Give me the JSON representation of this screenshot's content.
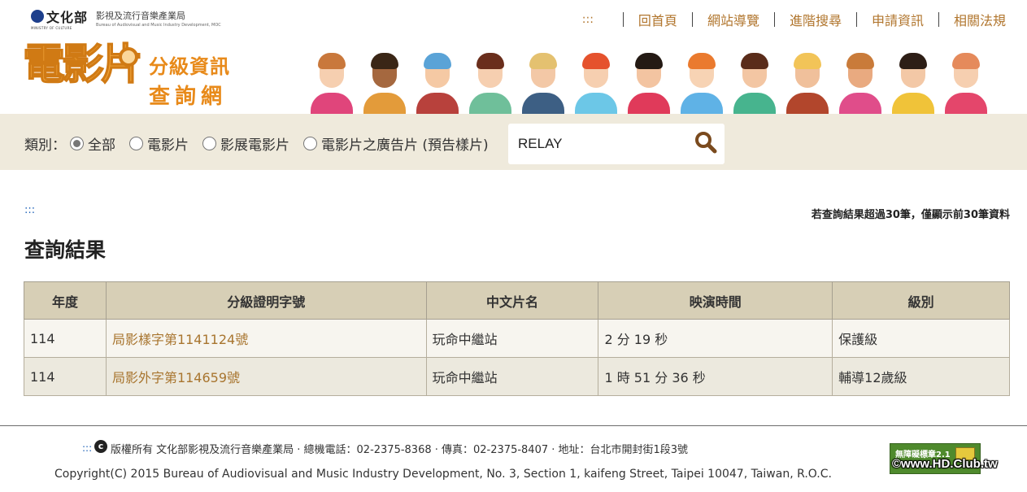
{
  "header": {
    "ministry_zh": "文化部",
    "ministry_en": "MINISTRY OF CULTURE",
    "bureau_zh": "影視及流行音樂產業局",
    "bureau_en": "Bureau of Audiovisual and Music Industry Development, MOC",
    "accesskey": ":::",
    "nav": [
      "回首頁",
      "網站導覽",
      "進階搜尋",
      "申請資訊",
      "相關法規"
    ]
  },
  "brand": {
    "main": "電影片",
    "line1": "分級資訊",
    "line2": "查詢網"
  },
  "people_colors": [
    {
      "hair": "#c9783c",
      "skin": "#f6cfb0",
      "shirt": "#e0457b"
    },
    {
      "hair": "#3a2616",
      "skin": "#a5683f",
      "shirt": "#e39b3a"
    },
    {
      "hair": "#5aa3d7",
      "skin": "#f5c9a4",
      "shirt": "#b8413c"
    },
    {
      "hair": "#6a2e1c",
      "skin": "#f6cfb0",
      "shirt": "#6fbf9a"
    },
    {
      "hair": "#e4c170",
      "skin": "#f3c8a6",
      "shirt": "#3d5f84"
    },
    {
      "hair": "#e5522d",
      "skin": "#f6cfb0",
      "shirt": "#6cc7e7"
    },
    {
      "hair": "#241a14",
      "skin": "#f3c4a1",
      "shirt": "#e03a5a"
    },
    {
      "hair": "#ea7a2e",
      "skin": "#f7d3b4",
      "shirt": "#5fb2e6"
    },
    {
      "hair": "#5a2c1a",
      "skin": "#f3c6a3",
      "shirt": "#47b48e"
    },
    {
      "hair": "#f2c458",
      "skin": "#f0c09b",
      "shirt": "#b2462c"
    },
    {
      "hair": "#c97b3a",
      "skin": "#e9aa80",
      "shirt": "#e04d8a"
    },
    {
      "hair": "#2d1e16",
      "skin": "#f3c8a6",
      "shirt": "#f0c339"
    },
    {
      "hair": "#e58a5b",
      "skin": "#f6cfb0",
      "shirt": "#e4466b"
    }
  ],
  "filter": {
    "label": "類別：",
    "options": [
      "全部",
      "電影片",
      "影展電影片",
      "電影片之廣告片 (預告樣片)"
    ],
    "selected": "全部",
    "search_value": "RELAY",
    "search_icon": "search-icon"
  },
  "main": {
    "accesskey": ":::",
    "note": "若查詢結果超過30筆，僅顯示前30筆資料",
    "title": "查詢結果"
  },
  "table": {
    "columns": [
      "年度",
      "分級證明字號",
      "中文片名",
      "映演時間",
      "級別"
    ],
    "rows": [
      [
        "114",
        "局影樣字第1141124號",
        "玩命中繼站",
        "2 分 19 秒",
        "保護級"
      ],
      [
        "114",
        "局影外字第114659號",
        "玩命中繼站",
        "1 時 51 分 36 秒",
        "輔導12歲級"
      ]
    ]
  },
  "footer": {
    "accesskey": ":::",
    "copyright_symbol": "c",
    "info": "版權所有  文化部影視及流行音樂產業局 · 總機電話：02-2375-8368 · 傳真：02-2375-8407 · 地址：台北市開封街1段3號",
    "english": "Copyright(C) 2015 Bureau of Audiovisual and Music Industry Development, No. 3, Section 1, kaifeng Street, Taipei 10047, Taiwan, R.O.C.",
    "badge_text": "無障礙標章2.1",
    "watermark": "©www.HD.Club.tw"
  },
  "colors": {
    "nav_link": "#b1762e",
    "filter_bg": "#efeadc",
    "table_header_bg": "#d7cfb6",
    "link": "#a8752f",
    "accesskey": "#1f62b8"
  }
}
